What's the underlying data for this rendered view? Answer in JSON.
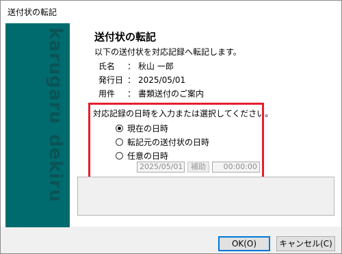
{
  "window": {
    "title": "送付状の転記"
  },
  "banner": {
    "brand_top": "karugaru",
    "brand_bottom": "dekiru"
  },
  "dialog": {
    "heading": "送付状の転記",
    "subtitle": "以下の送付状を対応記録へ転記します。",
    "info": [
      {
        "label": "氏名",
        "sep": "：",
        "value": "秋山 一郎"
      },
      {
        "label": "発行日",
        "sep": "：",
        "value": "2025/05/01"
      },
      {
        "label": "用件",
        "sep": "：",
        "value": "書類送付のご案内"
      }
    ],
    "datetime_prompt": "対応記録の日時を入力または選択してください。",
    "options": [
      {
        "label": "現在の日時",
        "selected": true
      },
      {
        "label": "転記元の送付状の日時",
        "selected": false
      },
      {
        "label": "任意の日時",
        "selected": false
      }
    ],
    "custom_date": "2025/05/01",
    "assist_button": "補助",
    "custom_time": "00:00:00"
  },
  "buttons": {
    "ok": "OK(O)",
    "cancel": "キャンセル(C)"
  },
  "colors": {
    "banner": "#006b6e",
    "highlight": "#e81c2d",
    "focus": "#0078d7"
  }
}
